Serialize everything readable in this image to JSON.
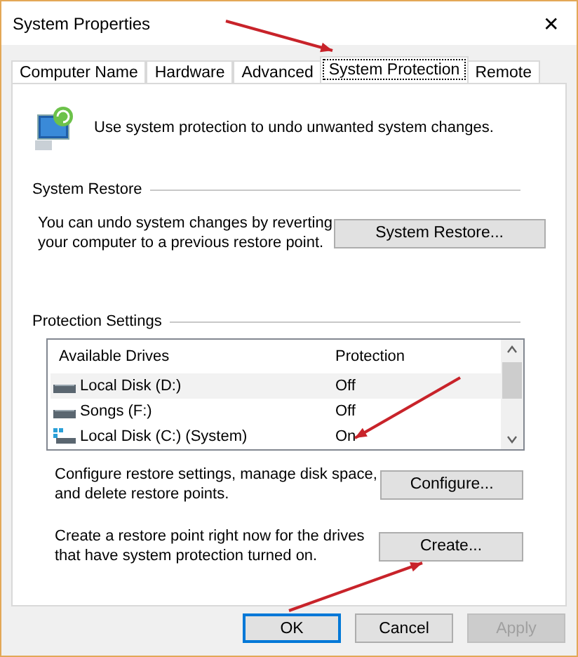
{
  "window": {
    "title": "System Properties",
    "close": "✕"
  },
  "tabs": [
    {
      "label": "Computer Name",
      "selected": false
    },
    {
      "label": "Hardware",
      "selected": false
    },
    {
      "label": "Advanced",
      "selected": false
    },
    {
      "label": "System Protection",
      "selected": true
    },
    {
      "label": "Remote",
      "selected": false
    }
  ],
  "intro": "Use system protection to undo unwanted system changes.",
  "system_restore": {
    "heading": "System Restore",
    "description": "You can undo system changes by reverting your computer to a previous restore point.",
    "button": "System Restore..."
  },
  "protection_settings": {
    "heading": "Protection Settings",
    "columns": [
      "Available Drives",
      "Protection"
    ],
    "rows": [
      {
        "drive": "Local Disk (D:)",
        "protection": "Off",
        "kind": "disk",
        "selected": true
      },
      {
        "drive": "Songs (F:)",
        "protection": "Off",
        "kind": "disk",
        "selected": false
      },
      {
        "drive": "Local Disk (C:) (System)",
        "protection": "On",
        "kind": "system",
        "selected": false
      }
    ],
    "configure": {
      "description": "Configure restore settings, manage disk space, and delete restore points.",
      "button": "Configure..."
    },
    "create": {
      "description": "Create a restore point right now for the drives that have system protection turned on.",
      "button": "Create..."
    }
  },
  "buttons": [
    {
      "label": "OK",
      "default": true,
      "disabled": false
    },
    {
      "label": "Cancel",
      "default": false,
      "disabled": false
    },
    {
      "label": "Apply",
      "default": false,
      "disabled": true
    }
  ]
}
